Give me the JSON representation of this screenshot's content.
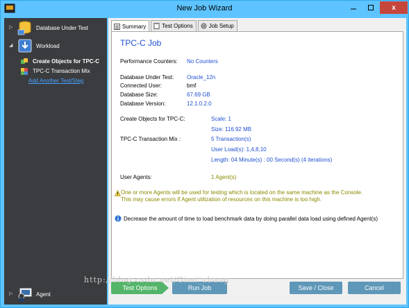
{
  "window": {
    "title": "New Job Wizard",
    "close_label": "x"
  },
  "sidebar": {
    "items": [
      {
        "label": "Database Under Test"
      },
      {
        "label": "Workload"
      },
      {
        "label": "Agent"
      }
    ],
    "workload_subitems": [
      {
        "label": "Create Objects for TPC-C"
      },
      {
        "label": "TPC-C Transaction Mix"
      }
    ],
    "add_test_link": "Add Another Test/Step"
  },
  "tabs": [
    {
      "label": "Summary"
    },
    {
      "label": "Test Options"
    },
    {
      "label": "Job Setup"
    }
  ],
  "summary": {
    "title": "TPC-C Job",
    "perf_counters_label": "Performance Counters:",
    "perf_counters_value": "No Counters",
    "db_under_test_label": "Database Under Test:",
    "db_under_test_value": "Oracle_12n",
    "connected_user_label": "Connected User:",
    "connected_user_value": "bmf",
    "db_size_label": "Database Size:",
    "db_size_value": "67.69 GB",
    "db_version_label": "Database Version:",
    "db_version_value": "12.1.0.2.0",
    "create_objects_label": "Create Objects for TPC-C:",
    "scale_value": "Scale: 1",
    "size_value": "Size: 116.92 MB",
    "transaction_mix_label": "TPC-C Transaction Mix :",
    "transactions_value": "5 Transaction(s)",
    "user_loads_value": "User Load(s): 1,4,8,10",
    "length_value": "Length: 04 Minute(s) : 00 Second(s) (4 iterations)",
    "user_agents_label": "User Agents:",
    "user_agents_value": "1 Agent(s)",
    "warning_line1": "One or more Agents will be used for testing which is located on the same machine as the Console.",
    "warning_line2": "This may cause errors if Agent utilization of resources on this machine is too high.",
    "info_text": "Decrease the amount of time to load benchmark data by doing parallel data load using defined Agent(s)"
  },
  "buttons": {
    "test_options": "Test Options",
    "run_job": "Run Job",
    "save_close": "Save / Close",
    "cancel": "Cancel"
  },
  "watermark": "http://blog.csdn.net/Gimi_zhang"
}
